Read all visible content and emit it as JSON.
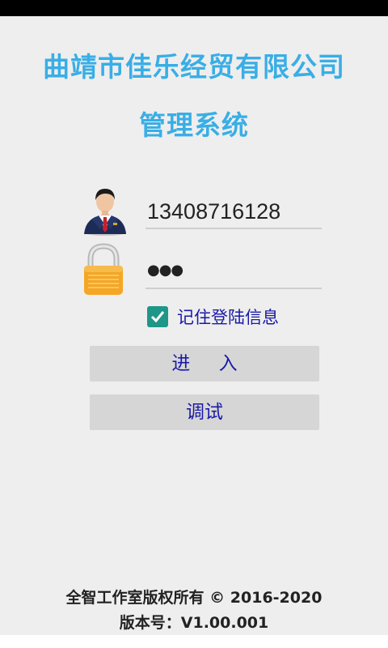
{
  "header": {
    "company_name": "曲靖市佳乐经贸有限公司",
    "system_name": "管理系统"
  },
  "login": {
    "username_value": "13408716128",
    "password_mask": "●●●",
    "user_icon": "user-avatar-icon",
    "lock_icon": "padlock-icon",
    "remember_checked": true,
    "remember_label": "记住登陆信息",
    "login_label": "进 入",
    "debug_label": "调试"
  },
  "footer": {
    "copyright": "全智工作室版权所有 © 2016-2020",
    "version": "版本号：V1.00.001"
  },
  "colors": {
    "title": "#39aee6",
    "button_text": "#1a1aa8",
    "checkbox": "#1e9688",
    "button_bg": "#d6d6d6",
    "background": "#eeeeee"
  }
}
